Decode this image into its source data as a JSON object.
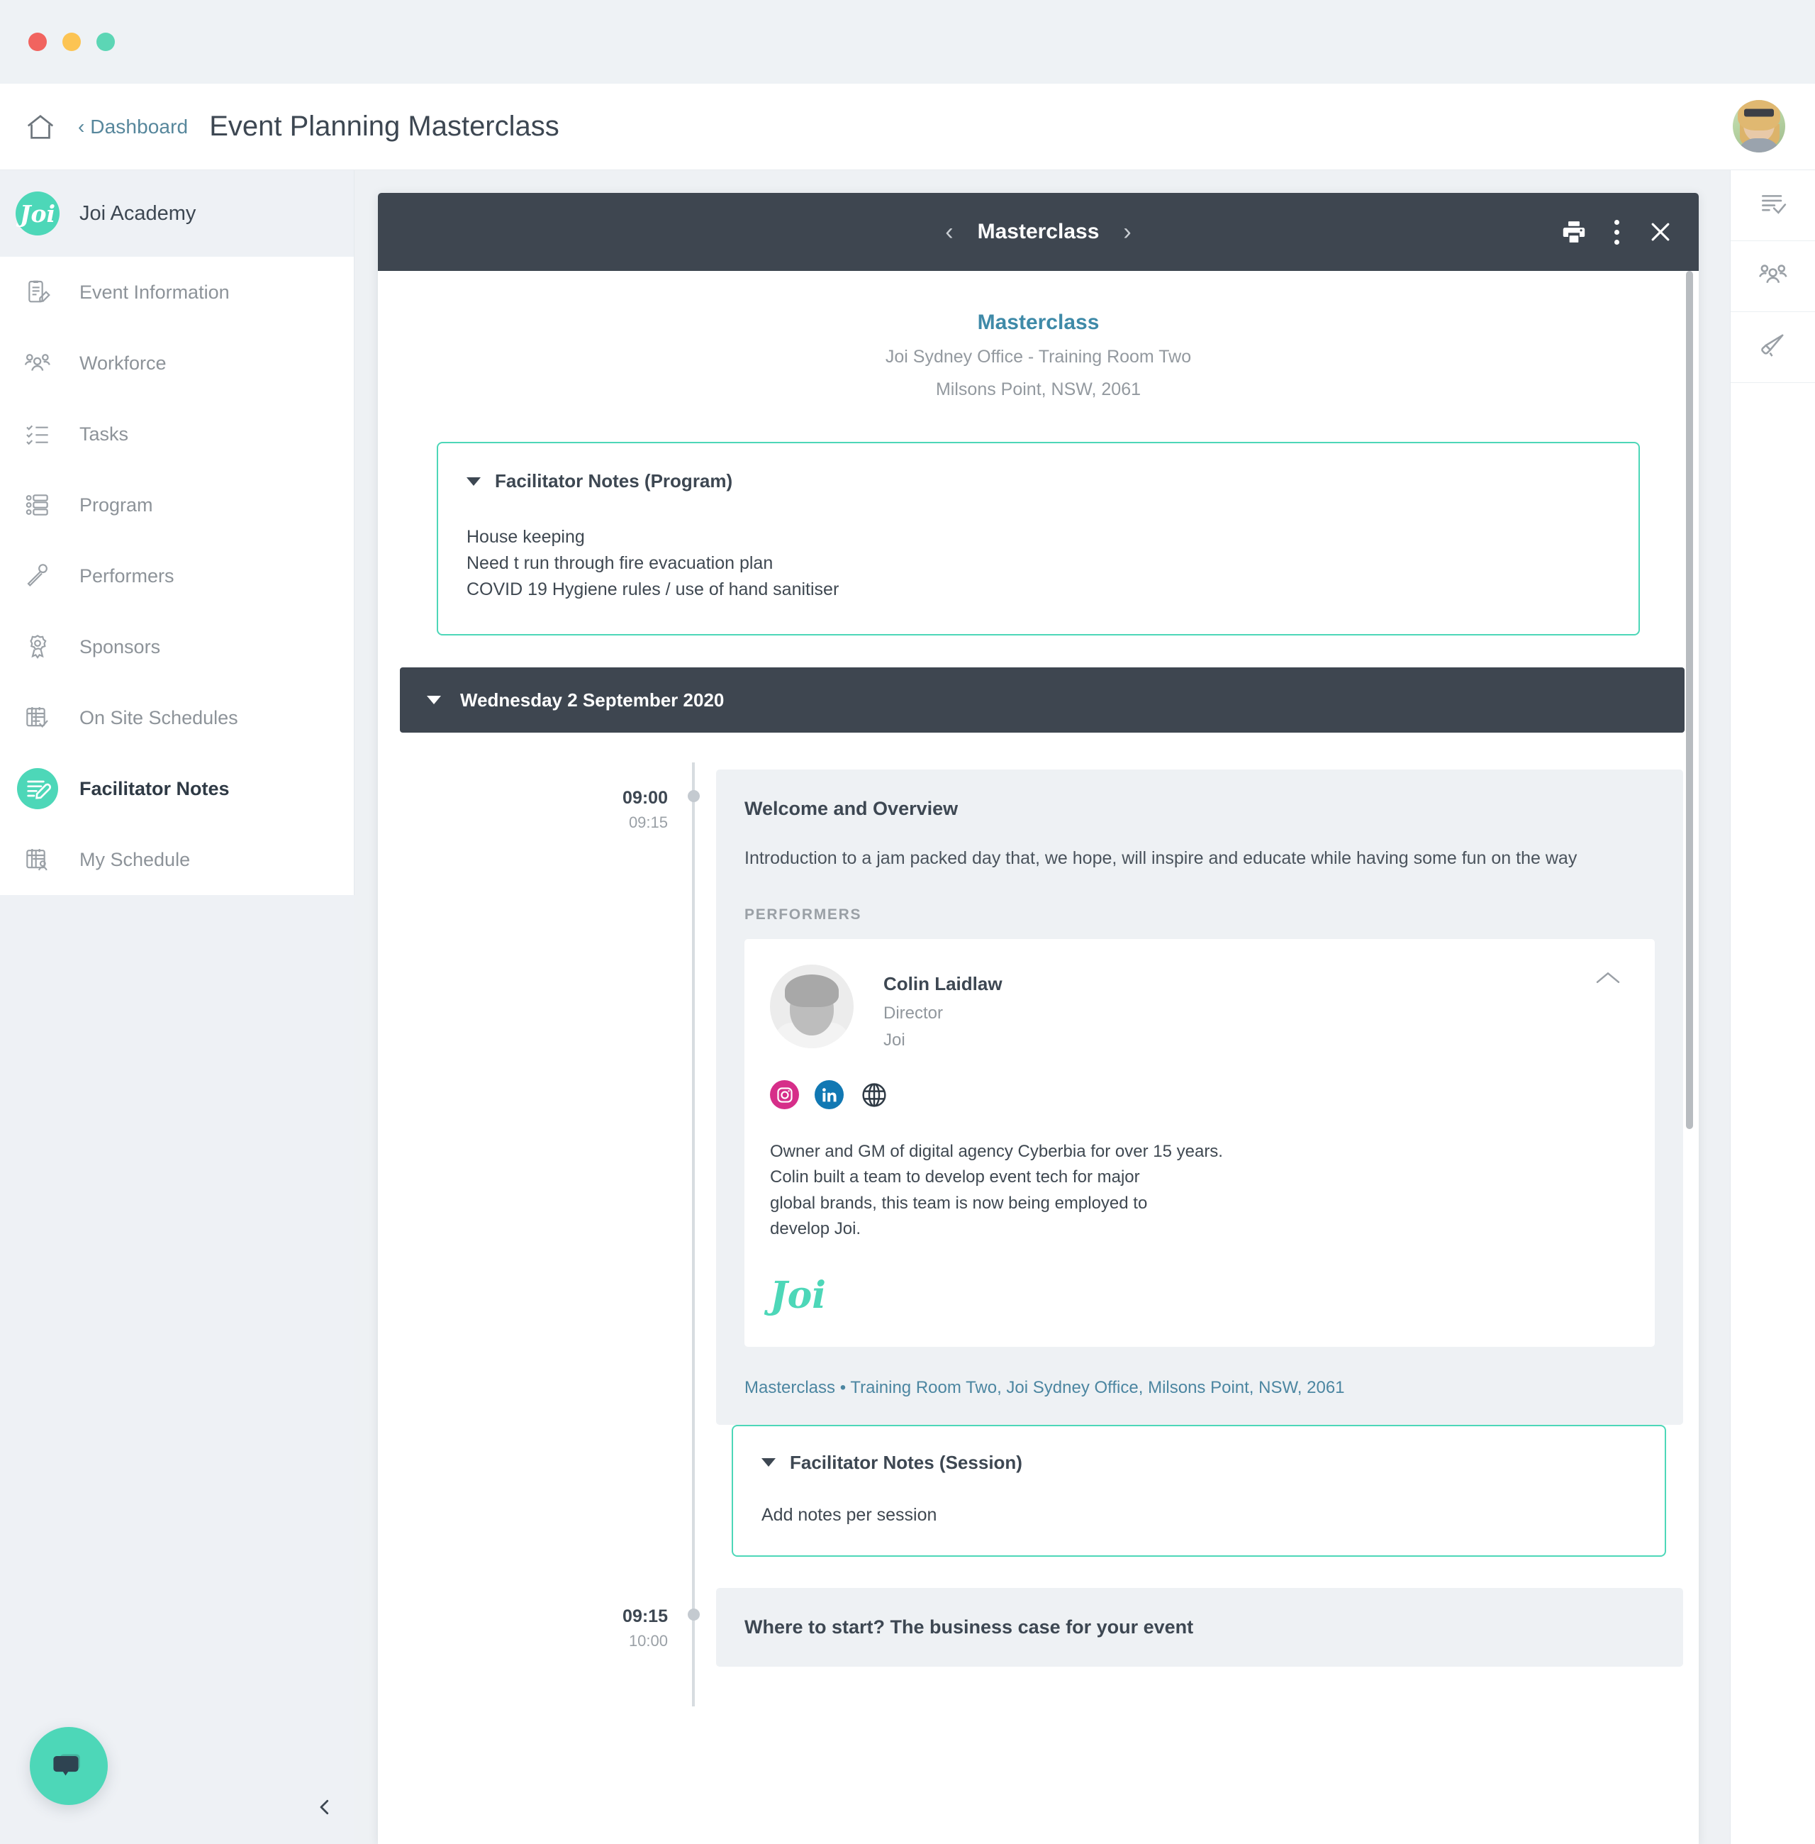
{
  "window": {
    "traffic_lights": [
      "close",
      "minimize",
      "zoom"
    ]
  },
  "header": {
    "home_icon": "home-icon",
    "breadcrumb": "‹ Dashboard",
    "title": "Event Planning Masterclass",
    "avatar": "user-avatar"
  },
  "sidebar": {
    "brand": {
      "logo_text": "Joi",
      "name": "Joi Academy"
    },
    "items": [
      {
        "label": "Event Information",
        "icon": "clipboard-edit-icon",
        "active": false
      },
      {
        "label": "Workforce",
        "icon": "people-group-icon",
        "active": false
      },
      {
        "label": "Tasks",
        "icon": "checklist-icon",
        "active": false
      },
      {
        "label": "Program",
        "icon": "program-list-icon",
        "active": false
      },
      {
        "label": "Performers",
        "icon": "microphone-icon",
        "active": false
      },
      {
        "label": "Sponsors",
        "icon": "award-ribbon-icon",
        "active": false
      },
      {
        "label": "On Site Schedules",
        "icon": "calendar-check-icon",
        "active": false
      },
      {
        "label": "Facilitator Notes",
        "icon": "notes-microphone-icon",
        "active": true
      },
      {
        "label": "My Schedule",
        "icon": "calendar-person-icon",
        "active": false
      }
    ],
    "chat_button": "chat-bubble-icon",
    "collapse_button": "chevron-left-icon"
  },
  "right_rail": {
    "items": [
      {
        "icon": "task-list-check-icon"
      },
      {
        "icon": "audience-people-icon"
      },
      {
        "icon": "megaphone-icon"
      }
    ]
  },
  "modal": {
    "nav_prev": "‹",
    "nav_next": "›",
    "title": "Masterclass",
    "print_icon": "printer-icon",
    "menu_icon": "kebab-menu-icon",
    "close_icon": "close-icon",
    "event": {
      "name": "Masterclass",
      "venue": "Joi Sydney Office - Training Room Two",
      "address": "Milsons Point, NSW, 2061"
    },
    "program_notes": {
      "heading": "Facilitator Notes (Program)",
      "lines": [
        "House keeping",
        "Need t run through fire evacuation plan",
        "COVID 19 Hygiene rules / use of hand sanitiser"
      ]
    },
    "day": {
      "label": "Wednesday 2 September 2020"
    },
    "sessions": [
      {
        "start": "09:00",
        "end": "09:15",
        "title": "Welcome and Overview",
        "description": "Introduction to a jam packed day that, we hope, will inspire and educate while having some fun on the way",
        "performers_label": "PERFORMERS",
        "performer": {
          "name": "Colin Laidlaw",
          "role": "Director",
          "org": "Joi",
          "socials": [
            {
              "name": "instagram-icon",
              "color": "#d62e89"
            },
            {
              "name": "linkedin-icon",
              "color": "#1178b3"
            },
            {
              "name": "website-globe-icon",
              "color": "#2f3a45"
            }
          ],
          "bio": [
            "Owner and GM of digital agency Cyberbia for over 15 years.",
            "Colin built a team to develop event tech for major",
            "global brands, this team is now being employed to",
            "develop Joi."
          ],
          "brand_logo": "Joi",
          "collapse_icon": "chevron-up-icon"
        },
        "location_link": "Masterclass • Training Room Two, Joi Sydney Office, Milsons Point, NSW, 2061",
        "session_notes": {
          "heading": "Facilitator Notes (Session)",
          "body": "Add notes per session"
        }
      },
      {
        "start": "09:15",
        "end": "10:00",
        "title": "Where to start? The business case for your event"
      }
    ]
  },
  "colors": {
    "accent": "#4dd7b8",
    "dark": "#3e4650",
    "link": "#4c86a1",
    "muted": "#91979d"
  }
}
